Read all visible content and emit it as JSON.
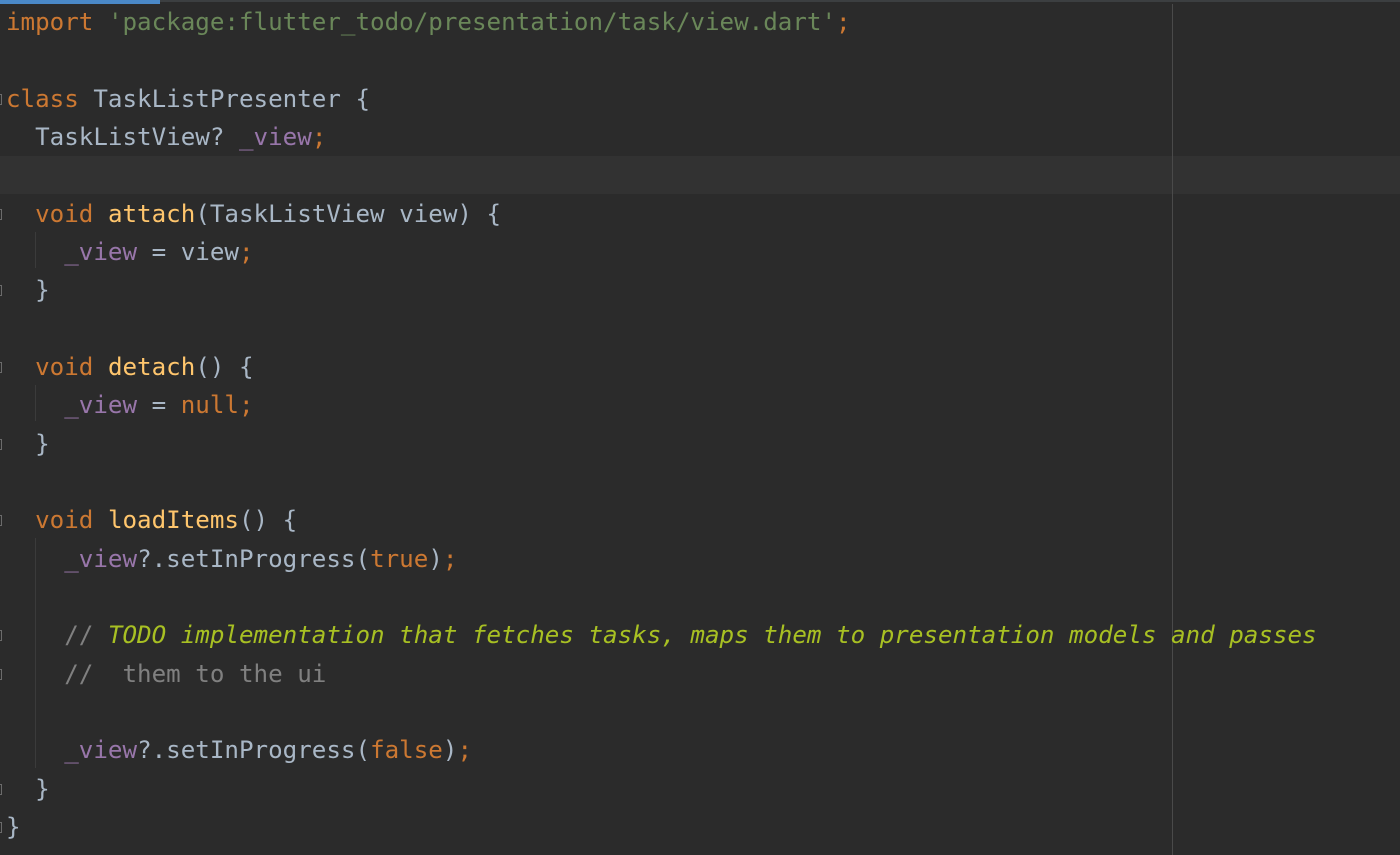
{
  "editor": {
    "language": "Dart",
    "theme": "Darcula",
    "colors": {
      "background": "#2b2b2b",
      "keyword": "#cc7832",
      "string": "#6a8759",
      "identifier": "#a9b7c6",
      "function": "#ffc66d",
      "field": "#9876aa",
      "todo": "#a8c023",
      "comment": "#808080"
    },
    "lines": {
      "l1": {
        "import_kw": "import",
        "path": "'package:flutter_todo/presentation/task/view.dart'",
        "semicolon": ";"
      },
      "l3": {
        "class_kw": "class",
        "class_name": "TaskListPresenter",
        "brace": "{"
      },
      "l4": {
        "type": "TaskListView?",
        "field": "_view",
        "semicolon": ";"
      },
      "l6": {
        "void_kw": "void",
        "method": "attach",
        "params": "(TaskListView view) {"
      },
      "l7": {
        "field": "_view",
        "assign": " = view",
        "semicolon": ";"
      },
      "l8": {
        "brace": "}"
      },
      "l10": {
        "void_kw": "void",
        "method": "detach",
        "params": "() {"
      },
      "l11": {
        "field": "_view",
        "assign": " = ",
        "null_kw": "null",
        "semicolon": ";"
      },
      "l12": {
        "brace": "}"
      },
      "l14": {
        "void_kw": "void",
        "method": "loadItems",
        "params": "() {"
      },
      "l15": {
        "field": "_view",
        "call": "?.setInProgress(",
        "arg": "true",
        "close": ")",
        "semicolon": ";"
      },
      "l17": {
        "comment_prefix": "// ",
        "todo_text": "TODO implementation that fetches tasks, maps them to presentation models and passes"
      },
      "l18": {
        "comment_text": "//  them to the ui"
      },
      "l20": {
        "field": "_view",
        "call": "?.setInProgress(",
        "arg": "false",
        "close": ")",
        "semicolon": ";"
      },
      "l21": {
        "brace": "}"
      },
      "l22": {
        "brace": "}"
      }
    }
  }
}
